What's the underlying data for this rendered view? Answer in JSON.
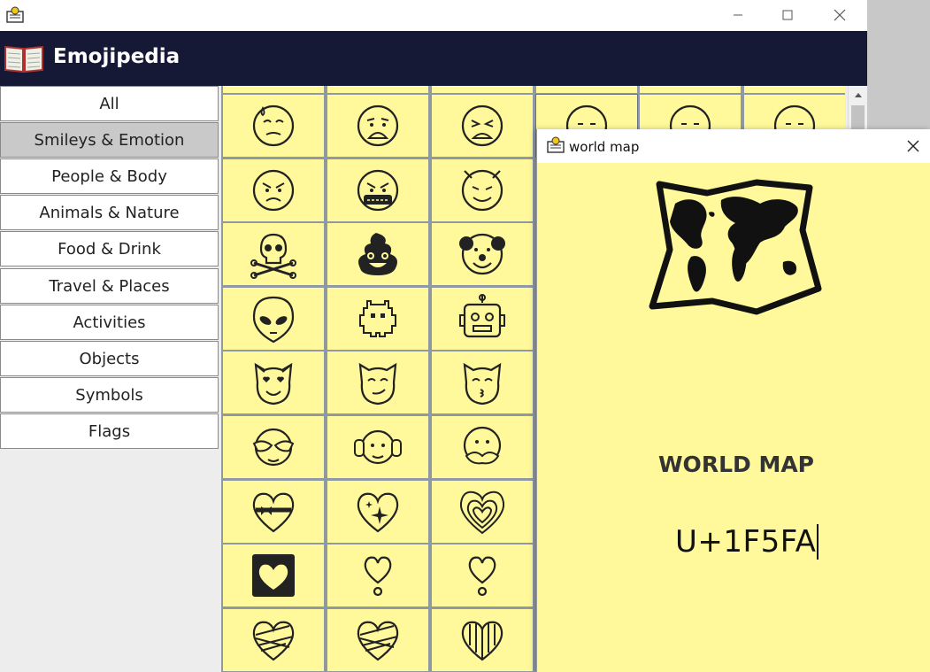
{
  "app": {
    "title": "Emojipedia",
    "window_controls": [
      "minimize",
      "maximize",
      "close"
    ]
  },
  "categories": [
    {
      "label": "All",
      "selected": false
    },
    {
      "label": "Smileys & Emotion",
      "selected": true
    },
    {
      "label": "People & Body",
      "selected": false
    },
    {
      "label": "Animals & Nature",
      "selected": false
    },
    {
      "label": "Food & Drink",
      "selected": false
    },
    {
      "label": "Travel & Places",
      "selected": false
    },
    {
      "label": "Activities",
      "selected": false
    },
    {
      "label": "Objects",
      "selected": false
    },
    {
      "label": "Symbols",
      "selected": false
    },
    {
      "label": "Flags",
      "selected": false
    }
  ],
  "grid": {
    "rows": [
      [
        "downcast-face-with-sweat-icon",
        "anguished-face-icon",
        "tired-face-icon",
        "face-icon",
        "face-icon",
        "face-icon"
      ],
      [
        "angry-face-icon",
        "face-with-symbols-on-mouth-icon",
        "smiling-face-with-horns-icon"
      ],
      [
        "skull-and-crossbones-icon",
        "pile-of-poo-icon",
        "clown-face-icon"
      ],
      [
        "alien-icon",
        "alien-monster-icon",
        "robot-icon"
      ],
      [
        "smiling-cat-with-heart-eyes-icon",
        "cat-with-wry-smile-icon",
        "kissing-cat-icon"
      ],
      [
        "see-no-evil-monkey-icon",
        "hear-no-evil-monkey-icon",
        "speak-no-evil-monkey-icon"
      ],
      [
        "heart-with-ribbon-icon",
        "sparkling-heart-icon",
        "growing-heart-icon"
      ],
      [
        "heart-decoration-icon",
        "heart-exclamation-icon",
        "heart-exclamation-icon"
      ],
      [
        "mending-heart-icon",
        "mending-heart-icon",
        "striped-heart-icon"
      ]
    ],
    "cell_color": "#fff99c",
    "line_color": "#8e99a4"
  },
  "detail_window": {
    "title": "world map",
    "emoji_icon": "world-map-icon",
    "name": "WORLD MAP",
    "code": "U+1F5FA"
  },
  "colors": {
    "header_bg": "#161936",
    "selected_category": "#c9c9c9"
  }
}
